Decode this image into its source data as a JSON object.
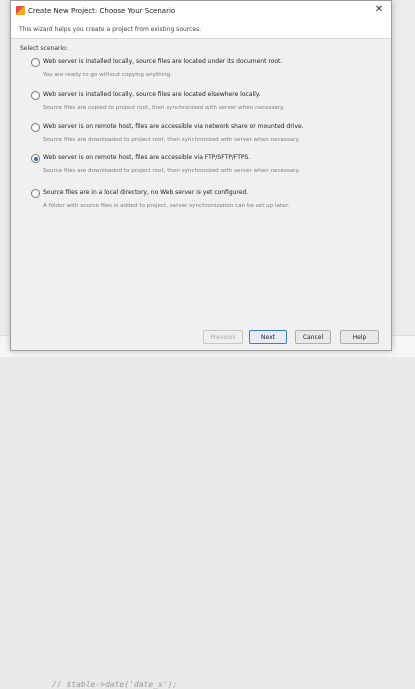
{
  "window": {
    "title": "Create New Project: Choose Your Scenario",
    "close_glyph": "✕"
  },
  "banner": {
    "text": "This wizard helps you create a project from existing sources."
  },
  "select_label": "Select scenario:",
  "options": [
    {
      "label": "Web server is installed locally, source files are located under its document root.",
      "description": "You are ready to go without copying anything.",
      "selected": false
    },
    {
      "label": "Web server is installed locally, source files are located elsewhere locally.",
      "description": "Source files are copied to project root, then synchronized with server when necessary.",
      "selected": false
    },
    {
      "label": "Web server is on remote host, files are accessible via network share or mounted drive.",
      "description": "Source files are downloaded to project root, then synchronized with server when necessary.",
      "selected": false
    },
    {
      "label": "Web server is on remote host, files are accessible via FTP/SFTP/FTPS.",
      "description": "Source files are downloaded to project root, then synchronized with server when necessary.",
      "selected": true
    },
    {
      "label": "Source files are in a local directory, no Web server is yet configured.",
      "description": "A folder with source files is added to project, server synchronization can be set up later.",
      "selected": false
    }
  ],
  "buttons": {
    "previous": "Previous",
    "next": "Next",
    "cancel": "Cancel",
    "help": "Help"
  },
  "background": {
    "code_line": "//    $table->date('date_x');"
  },
  "colors": {
    "accent": "#3e7bd0",
    "radio_dot": "#3d6fb0"
  }
}
